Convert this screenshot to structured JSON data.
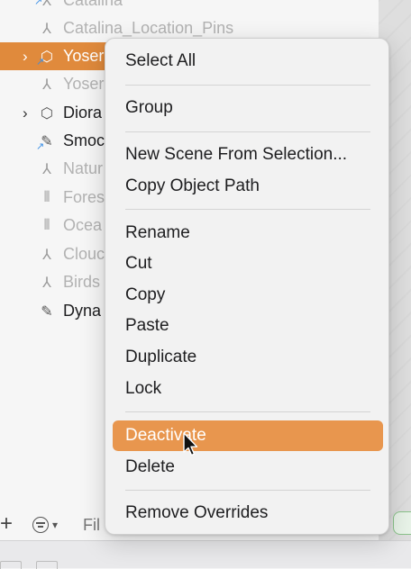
{
  "outline": {
    "rows": [
      {
        "label": "Catalina",
        "icon": "node-icon",
        "dim": true
      },
      {
        "label": "Catalina_Location_Pins",
        "icon": "node-icon",
        "dim": true
      },
      {
        "label": "Yoser",
        "icon": "cube-icon",
        "dim": false,
        "selected": true,
        "chevron": true
      },
      {
        "label": "Yoser",
        "icon": "node-icon",
        "dim": true
      },
      {
        "label": "Diora",
        "icon": "cube-icon",
        "dim": false,
        "chevron": true
      },
      {
        "label": "Smoc",
        "icon": "paint-icon",
        "dim": false
      },
      {
        "label": "Natur",
        "icon": "node-icon",
        "dim": true
      },
      {
        "label": "Fores",
        "icon": "sound-icon",
        "dim": true
      },
      {
        "label": "Ocea",
        "icon": "sound-icon",
        "dim": true
      },
      {
        "label": "Clouc",
        "icon": "node-icon",
        "dim": true
      },
      {
        "label": "Birds",
        "icon": "node-icon",
        "dim": true
      },
      {
        "label": "Dyna",
        "icon": "paint-icon",
        "dim": false
      }
    ],
    "filter_placeholder": "Fil"
  },
  "context_menu": {
    "select_all": "Select All",
    "group": "Group",
    "new_scene": "New Scene From Selection...",
    "copy_object_path": "Copy Object Path",
    "rename": "Rename",
    "cut": "Cut",
    "copy": "Copy",
    "paste": "Paste",
    "duplicate": "Duplicate",
    "lock": "Lock",
    "deactivate": "Deactivate",
    "delete": "Delete",
    "remove_overrides": "Remove Overrides"
  },
  "colors": {
    "selection": "#e08a3c",
    "menu_highlight": "#e8964e",
    "badge": "#3a8ee6"
  }
}
